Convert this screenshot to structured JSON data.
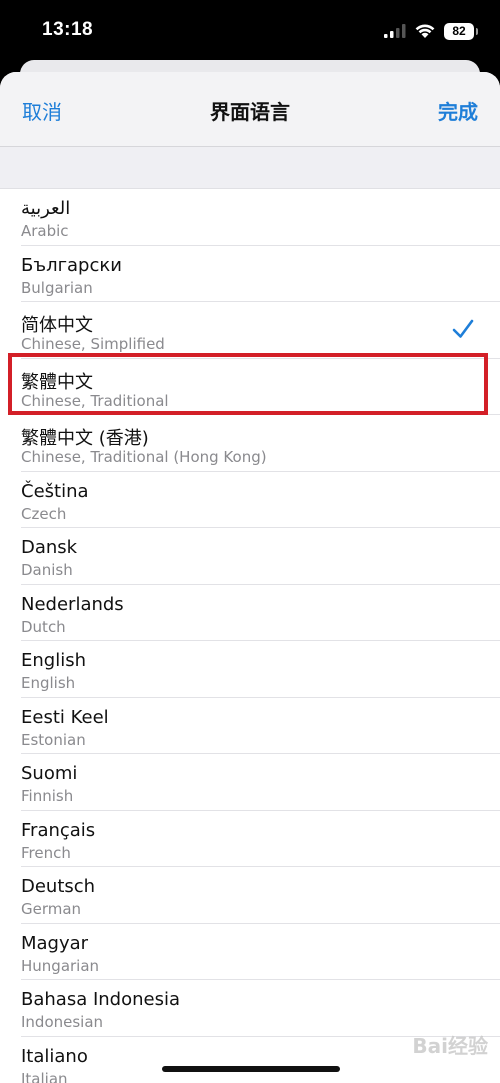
{
  "status_bar": {
    "time": "13:18",
    "battery": "82"
  },
  "nav": {
    "cancel": "取消",
    "title": "界面语言",
    "done": "完成"
  },
  "languages": [
    {
      "title": "العربية",
      "subtitle": "Arabic",
      "selected": false
    },
    {
      "title": "Български",
      "subtitle": "Bulgarian",
      "selected": false
    },
    {
      "title": "简体中文",
      "subtitle": "Chinese, Simplified",
      "selected": true
    },
    {
      "title": "繁體中文",
      "subtitle": "Chinese, Traditional",
      "selected": false
    },
    {
      "title": "繁體中文 (香港)",
      "subtitle": "Chinese, Traditional (Hong Kong)",
      "selected": false
    },
    {
      "title": "Čeština",
      "subtitle": "Czech",
      "selected": false
    },
    {
      "title": "Dansk",
      "subtitle": "Danish",
      "selected": false
    },
    {
      "title": "Nederlands",
      "subtitle": "Dutch",
      "selected": false
    },
    {
      "title": "English",
      "subtitle": "English",
      "selected": false
    },
    {
      "title": "Eesti Keel",
      "subtitle": "Estonian",
      "selected": false
    },
    {
      "title": "Suomi",
      "subtitle": "Finnish",
      "selected": false
    },
    {
      "title": "Français",
      "subtitle": "French",
      "selected": false
    },
    {
      "title": "Deutsch",
      "subtitle": "German",
      "selected": false
    },
    {
      "title": "Magyar",
      "subtitle": "Hungarian",
      "selected": false
    },
    {
      "title": "Bahasa Indonesia",
      "subtitle": "Indonesian",
      "selected": false
    },
    {
      "title": "Italiano",
      "subtitle": "Italian",
      "selected": false
    }
  ],
  "colors": {
    "accent": "#1e7ed8",
    "highlight": "#d31f27"
  },
  "watermark": "Bai经验"
}
